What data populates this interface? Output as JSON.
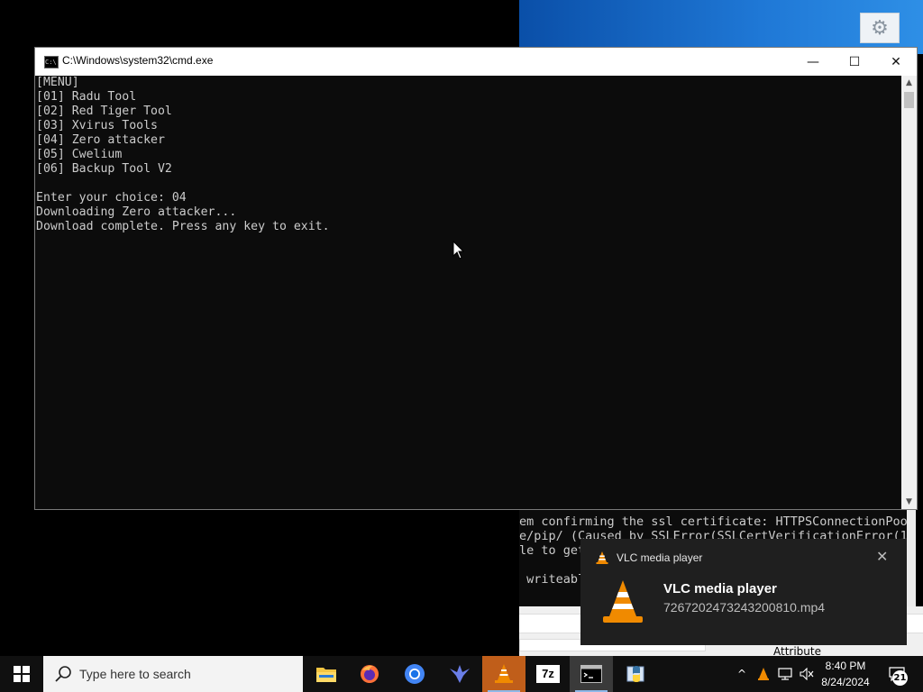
{
  "window": {
    "title": "C:\\Windows\\system32\\cmd.exe",
    "minimize_symbol": "—",
    "maximize_symbol": "☐",
    "close_symbol": "✕"
  },
  "console": {
    "lines": [
      "[MENU]",
      "[01] Radu Tool",
      "[02] Red Tiger Tool",
      "[03] Xvirus Tools",
      "[04] Zero attacker",
      "[05] Cwelium",
      "[06] Backup Tool V2",
      "",
      "Enter your choice: 04",
      "Downloading Zero attacker...",
      "Download complete. Press any key to exit."
    ]
  },
  "background_console": {
    "lines": [
      "em confirming the ssl certificate: HTTPSConnectionPoo",
      "e/pip/ (Caused by SSLError(SSLCertVerificationError(1",
      "le to get",
      "",
      " writeabl"
    ],
    "attribute_label": "Attribute"
  },
  "notification": {
    "app_name": "VLC media player",
    "title": "VLC media player",
    "body": "7267202473243200810.mp4",
    "close_symbol": "✕"
  },
  "taskbar": {
    "search_placeholder": "Type here to search",
    "apps": [
      "file-explorer",
      "firefox",
      "chrome",
      "app-bird",
      "vlc",
      "7zip",
      "cmd",
      "python-idle"
    ],
    "sevenzip_label": "7z",
    "tray_chevron": "^",
    "clock_time": "8:40 PM",
    "clock_date": "8/24/2024",
    "notification_count": "21"
  }
}
